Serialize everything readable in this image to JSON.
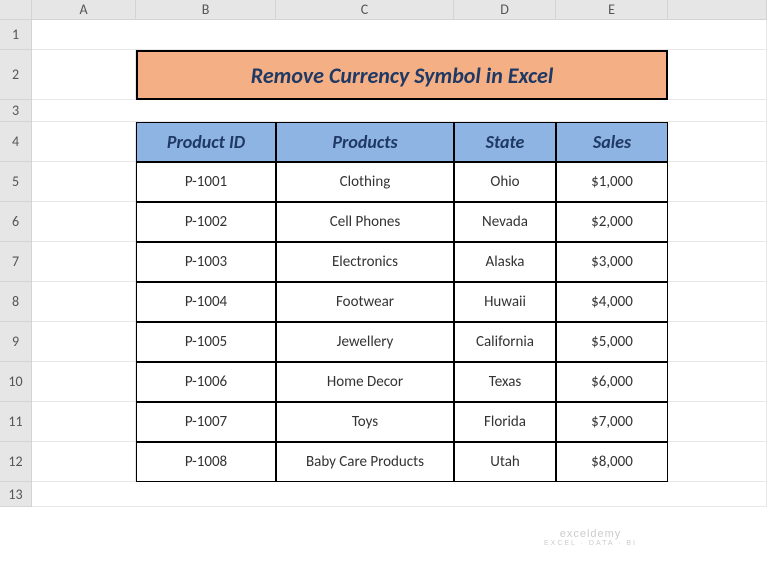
{
  "columns": [
    "A",
    "B",
    "C",
    "D",
    "E"
  ],
  "rows": [
    "1",
    "2",
    "3",
    "4",
    "5",
    "6",
    "7",
    "8",
    "9",
    "10",
    "11",
    "12",
    "13"
  ],
  "title": "Remove Currency Symbol in Excel",
  "table": {
    "headers": [
      "Product ID",
      "Products",
      "State",
      "Sales"
    ],
    "data": [
      [
        "P-1001",
        "Clothing",
        "Ohio",
        "$1,000"
      ],
      [
        "P-1002",
        "Cell Phones",
        "Nevada",
        "$2,000"
      ],
      [
        "P-1003",
        "Electronics",
        "Alaska",
        "$3,000"
      ],
      [
        "P-1004",
        "Footwear",
        "Huwaii",
        "$4,000"
      ],
      [
        "P-1005",
        "Jewellery",
        "California",
        "$5,000"
      ],
      [
        "P-1006",
        "Home Decor",
        "Texas",
        "$6,000"
      ],
      [
        "P-1007",
        "Toys",
        "Florida",
        "$7,000"
      ],
      [
        "P-1008",
        "Baby Care Products",
        "Utah",
        "$8,000"
      ]
    ]
  },
  "watermark": {
    "main": "exceldemy",
    "sub": "EXCEL · DATA · BI"
  }
}
